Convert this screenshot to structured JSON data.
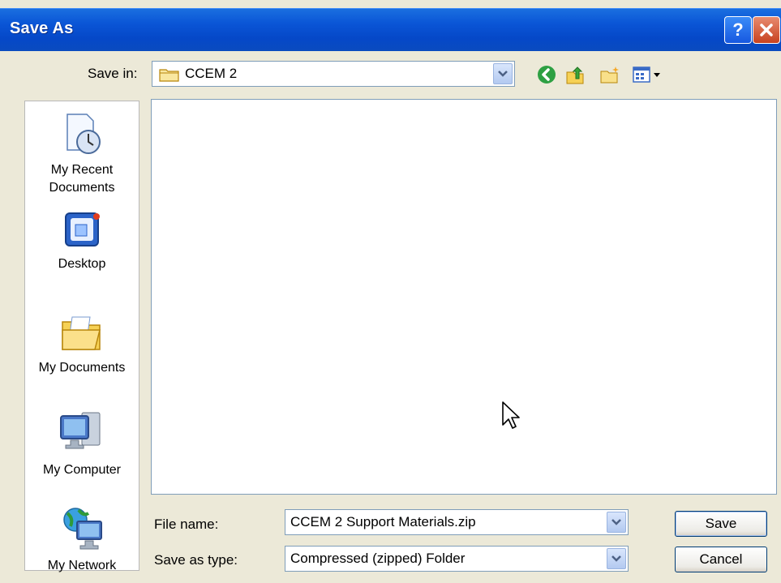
{
  "window": {
    "title": "Save As",
    "help_label": "?"
  },
  "toolbar": {
    "save_in_label": "Save in:",
    "save_in_value": "CCEM 2",
    "icons": [
      "back-icon",
      "up-folder-icon",
      "new-folder-icon",
      "views-menu-icon"
    ]
  },
  "places": [
    {
      "label": "My Recent\nDocuments",
      "icon": "recent-documents-icon"
    },
    {
      "label": "Desktop",
      "icon": "desktop-icon"
    },
    {
      "label": "My Documents",
      "icon": "my-documents-icon"
    },
    {
      "label": "My Computer",
      "icon": "my-computer-icon"
    },
    {
      "label": "My Network",
      "icon": "my-network-icon"
    }
  ],
  "form": {
    "file_name_label": "File name:",
    "file_name_value": "CCEM 2 Support Materials.zip",
    "save_type_label": "Save as type:",
    "save_type_value": "Compressed (zipped) Folder"
  },
  "buttons": {
    "save": "Save",
    "cancel": "Cancel"
  },
  "colors": {
    "titlebar": "#0a55d6",
    "dialog_bg": "#ece9d8",
    "close": "#c8421f"
  }
}
